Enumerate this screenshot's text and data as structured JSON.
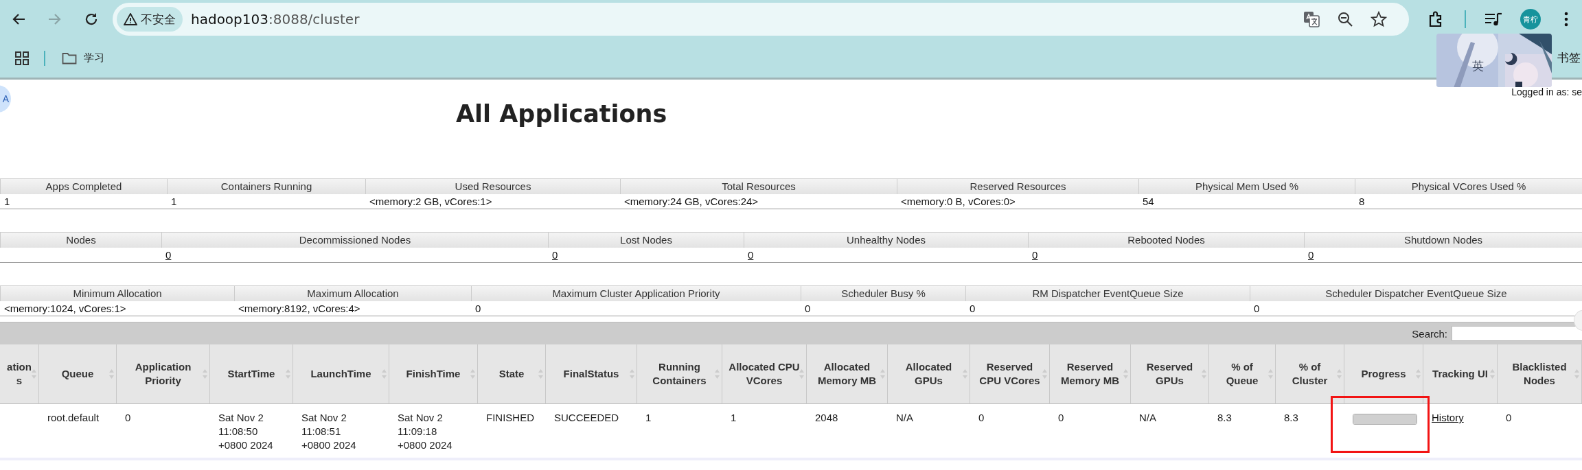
{
  "browser": {
    "security_label": "不安全",
    "host": "hadoop103",
    "path": ":8088/cluster",
    "forward_disabled": true,
    "avatar": "青柠",
    "bookmarks": [
      {
        "label": "学习"
      }
    ],
    "bookmarks_partial": "书签",
    "ime_label": "英",
    "floating_button": "A"
  },
  "page": {
    "logged_in": "Logged in as: se",
    "title": "All Applications"
  },
  "metric_tables": [
    {
      "columns": [
        "Apps Completed",
        "Containers Running",
        "Used Resources",
        "Total Resources",
        "Reserved Resources",
        "Physical Mem Used %",
        "Physical VCores Used %"
      ],
      "cells": [
        {
          "kind": "text",
          "text": "1"
        },
        {
          "kind": "text",
          "text": "1"
        },
        {
          "kind": "text",
          "text": "<memory:2 GB, vCores:1>"
        },
        {
          "kind": "text",
          "text": "<memory:24 GB, vCores:24>"
        },
        {
          "kind": "text",
          "text": "<memory:0 B, vCores:0>"
        },
        {
          "kind": "text",
          "text": "54"
        },
        {
          "kind": "text",
          "text": "8"
        }
      ]
    },
    {
      "columns": [
        "Nodes",
        "Decommissioned Nodes",
        "Lost Nodes",
        "Unhealthy Nodes",
        "Rebooted Nodes",
        "Shutdown Nodes"
      ],
      "cells": [
        {},
        {
          "kind": "link",
          "text": "0"
        },
        {
          "kind": "link",
          "text": "0"
        },
        {
          "kind": "link",
          "text": "0"
        },
        {
          "kind": "link",
          "text": "0"
        },
        {
          "kind": "link",
          "text": "0"
        }
      ]
    },
    {
      "columns": [
        "Minimum Allocation",
        "Maximum Allocation",
        "Maximum Cluster Application Priority",
        "Scheduler Busy %",
        "RM Dispatcher EventQueue Size",
        "Scheduler Dispatcher EventQueue Size"
      ],
      "cells": [
        {
          "kind": "text",
          "text": "<memory:1024, vCores:1>"
        },
        {
          "kind": "text",
          "text": "<memory:8192, vCores:4>"
        },
        {
          "kind": "text",
          "text": "0"
        },
        {
          "kind": "text",
          "text": "0"
        },
        {
          "kind": "text",
          "text": "0"
        },
        {
          "kind": "text",
          "text": "0"
        }
      ]
    }
  ],
  "apps_table": {
    "search_label": "Search:",
    "columns": [
      "ation s",
      "Queue",
      "Application Priority",
      "StartTime",
      "LaunchTime",
      "FinishTime",
      "State",
      "FinalStatus",
      "Running Containers",
      "Allocated CPU VCores",
      "Allocated Memory MB",
      "Allocated GPUs",
      "Reserved CPU VCores",
      "Reserved Memory MB",
      "Reserved GPUs",
      "% of Queue",
      "% of Cluster",
      "Progress",
      "Tracking UI",
      "Blacklisted Nodes"
    ],
    "rows": [
      {
        "cells": [
          {},
          {
            "kind": "text",
            "lines": [
              "root.default"
            ]
          },
          {
            "kind": "text",
            "lines": [
              "0"
            ]
          },
          {
            "kind": "text",
            "lines": [
              "Sat Nov 2",
              "11:08:50",
              "+0800 2024"
            ]
          },
          {
            "kind": "text",
            "lines": [
              "Sat Nov 2",
              "11:08:51",
              "+0800 2024"
            ]
          },
          {
            "kind": "text",
            "lines": [
              "Sat Nov 2",
              "11:09:18",
              "+0800 2024"
            ]
          },
          {
            "kind": "text",
            "lines": [
              "FINISHED"
            ]
          },
          {
            "kind": "text",
            "lines": [
              "SUCCEEDED"
            ]
          },
          {
            "kind": "text",
            "lines": [
              "1"
            ]
          },
          {
            "kind": "text",
            "lines": [
              "1"
            ]
          },
          {
            "kind": "text",
            "lines": [
              "2048"
            ]
          },
          {
            "kind": "text",
            "lines": [
              "N/A"
            ]
          },
          {
            "kind": "text",
            "lines": [
              "0"
            ]
          },
          {
            "kind": "text",
            "lines": [
              "0"
            ]
          },
          {
            "kind": "text",
            "lines": [
              "N/A"
            ]
          },
          {
            "kind": "text",
            "lines": [
              "8.3"
            ]
          },
          {
            "kind": "text",
            "lines": [
              "8.3"
            ]
          },
          {
            "kind": "progress",
            "level": 1
          },
          {
            "kind": "link",
            "lines": [
              "History"
            ]
          },
          {
            "kind": "text",
            "lines": [
              "0"
            ]
          }
        ]
      }
    ]
  }
}
